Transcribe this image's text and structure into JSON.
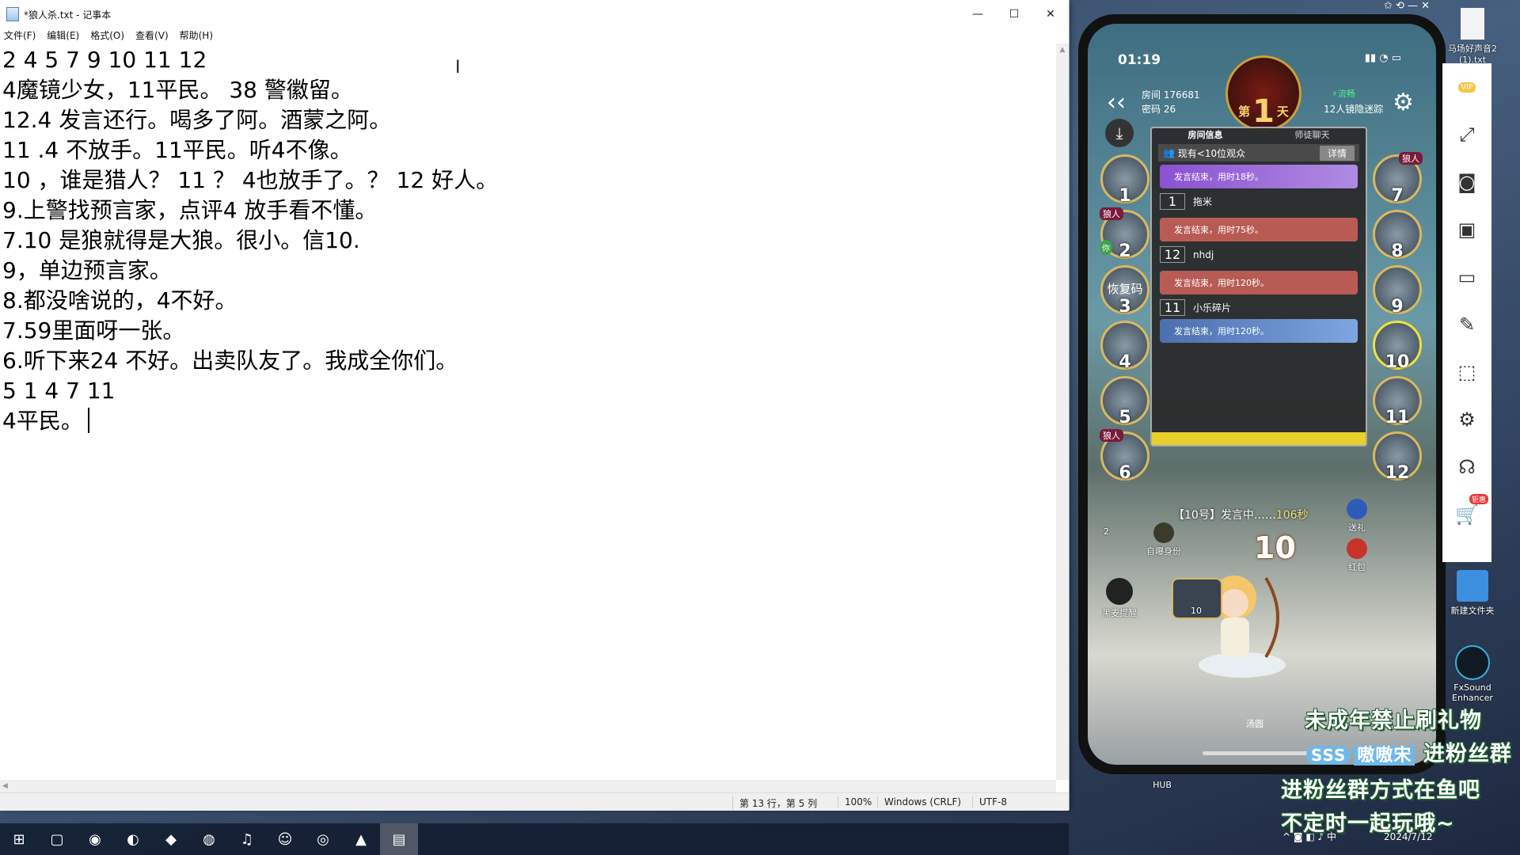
{
  "notepad": {
    "title": "*狼人杀.txt - 记事本",
    "controls": {
      "min": "—",
      "max": "☐",
      "close": "✕"
    },
    "menu": [
      "文件(F)",
      "编辑(E)",
      "格式(O)",
      "查看(V)",
      "帮助(H)"
    ],
    "lines": [
      "2 4 5 7 9 10 11 12",
      "4魔镜少女，11平民。 38 警徽留。",
      "12.4 发言还行。喝多了阿。酒蒙之阿。",
      "11 .4 不放手。11平民。听4不像。",
      "10 ，谁是猎人？ 11 ？ 4也放手了。？ 12 好人。",
      "9.上警找预言家，点评4 放手看不懂。",
      "7.10 是狼就得是大狼。很小。信10.",
      "9，单边预言家。",
      "8.都没啥说的，4不好。",
      "7.59里面呀一张。",
      "6.听下来24 不好。出卖队友了。我成全你们。",
      "5 1 4 7 11",
      "4平民。"
    ],
    "status": {
      "position": "第 13 行，第 5 列",
      "zoom": "100%",
      "eol": "Windows (CRLF)",
      "encoding": "UTF-8"
    }
  },
  "phone": {
    "time": "01:19",
    "day_prefix": "第",
    "day_number": "1",
    "day_suffix": "天",
    "room": "房间 176681",
    "password": "密码 26",
    "network": "流畅",
    "mode": "12人镜隐迷踪",
    "tabs": [
      "房间信息",
      "师徒聊天"
    ],
    "viewers": "现有<10位观众",
    "details_button": "详情",
    "messages": [
      {
        "seat": "",
        "name": "",
        "text": "发言结束，用时18秒。",
        "style": "purple"
      },
      {
        "seat": "1",
        "name": "拖米",
        "text": "发言结束，用时75秒。",
        "style": "red"
      },
      {
        "seat": "12",
        "name": "nhdj",
        "text": "发言结束，用时120秒。",
        "style": "red"
      },
      {
        "seat": "11",
        "name": "小乐碎片",
        "text": "发言结束，用时120秒。",
        "style": "blue"
      }
    ],
    "wolf_tag": "狼人",
    "you_tag": "你",
    "recover_code": "恢复码",
    "seats_left": [
      "1",
      "2",
      "3",
      "4",
      "5",
      "6"
    ],
    "seats_right": [
      "7",
      "8",
      "9",
      "10",
      "11",
      "12"
    ],
    "speaking_prefix": "【10号】发言中……",
    "speaking_time": "106秒",
    "center_number": "10",
    "gift_label": "送礼",
    "redpack_label": "红包",
    "reveal_label": "自曝身份",
    "mic_label": "黑麦提醒",
    "left_count": "2",
    "bottom_seat": "10",
    "bottom_nick": "汤圆"
  },
  "desktop": {
    "top_icon_label": "马场好声音2 (1).txt",
    "folder_label": "新建文件夹",
    "fxsound_label": "FxSound Enhancer",
    "hub_label": "HUB",
    "vip": "VIP",
    "sale_badge": "钜惠"
  },
  "promo": {
    "line1": "未成年禁止刷礼物",
    "tag": "SSS",
    "name": "嗷嗷宋",
    "join": "进粉丝群",
    "line3": "进粉丝群方式在鱼吧",
    "line4": "不定时一起玩哦~"
  },
  "tray": {
    "ime": "中",
    "date": "2024/7/12"
  },
  "colors": {
    "accent_wolf": "#7a1b3c",
    "network_green": "#4ef08e",
    "promo_outline": "#1c5b2c"
  }
}
